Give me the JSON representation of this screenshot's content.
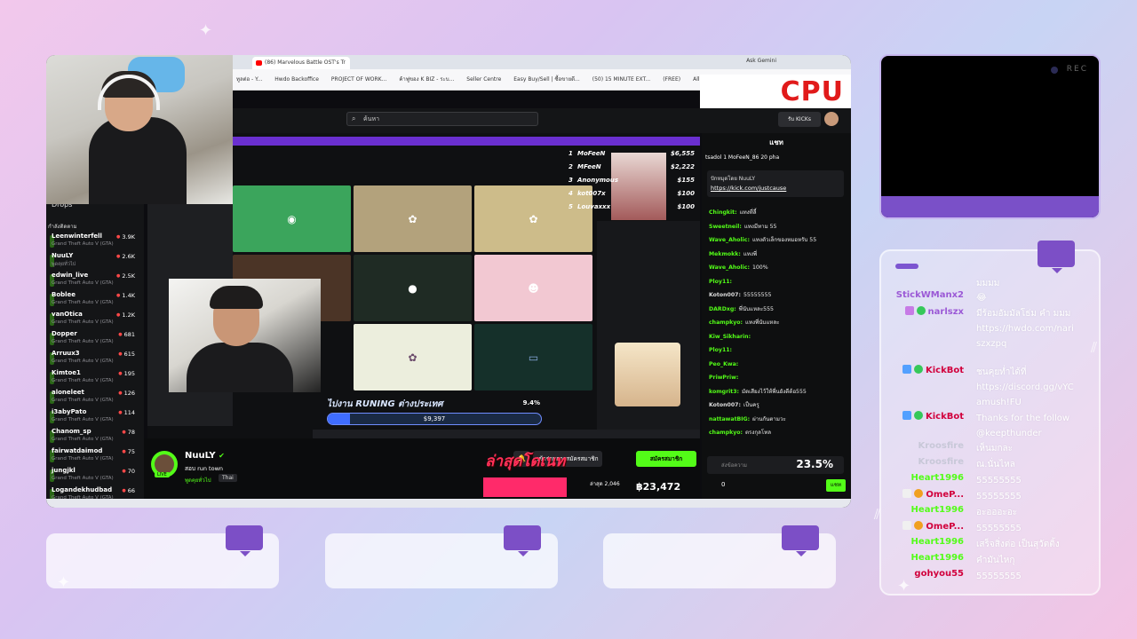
{
  "browser": {
    "tab_title": "(86) Marvelous Battle OST's Tr",
    "ask_gemini": "Ask Gemini",
    "bookmarks": [
      "ทูลต่อ - Y...",
      "Hwdo Backoffice",
      "PROJECT OF WORK...",
      "ค้าฟูของ K BIZ - ระบ...",
      "Seller Centre",
      "Easy Buy/Sell | ซื้อขายดี...",
      "(50) 15 MINUTE EXT...",
      "(FREE)",
      "All Bookmarks"
    ],
    "logo_text": "CPU"
  },
  "kick": {
    "search_placeholder": "ค้นหา",
    "kicks_button": "รับ KICKs"
  },
  "sidebar": {
    "drops_label": "Drops",
    "recommended_label": "กำลังติดตาม",
    "items": [
      {
        "name": "Leenwinterfell",
        "game": "Grand Theft Auto V (GTA)",
        "viewers": "3.9K"
      },
      {
        "name": "NuuLY",
        "game": "พูดคุยทั่วไป",
        "viewers": "2.6K"
      },
      {
        "name": "edwin_live",
        "game": "Grand Theft Auto V (GTA)",
        "viewers": "2.5K"
      },
      {
        "name": "Boblee",
        "game": "Grand Theft Auto V (GTA)",
        "viewers": "1.4K"
      },
      {
        "name": "vanOtica",
        "game": "Grand Theft Auto V (GTA)",
        "viewers": "1.2K"
      },
      {
        "name": "Dopper",
        "game": "Grand Theft Auto V (GTA)",
        "viewers": "681"
      },
      {
        "name": "Arruux3",
        "game": "Grand Theft Auto V (GTA)",
        "viewers": "615"
      },
      {
        "name": "Kimtoe1",
        "game": "Grand Theft Auto V (GTA)",
        "viewers": "195"
      },
      {
        "name": "aloneleet",
        "game": "Grand Theft Auto V (GTA)",
        "viewers": "126"
      },
      {
        "name": "i3abyPato",
        "game": "Grand Theft Auto V (GTA)",
        "viewers": "114"
      },
      {
        "name": "Chanom_sp",
        "game": "Grand Theft Auto V (GTA)",
        "viewers": "78"
      },
      {
        "name": "fairwatdaimod",
        "game": "Grand Theft Auto V (GTA)",
        "viewers": "75"
      },
      {
        "name": "jungjkl",
        "game": "Grand Theft Auto V (GTA)",
        "viewers": "70"
      },
      {
        "name": "Logandekhudbad",
        "game": "Grand Theft Auto V (GTA)",
        "viewers": "66"
      }
    ]
  },
  "leaderboard": [
    {
      "rank": "1",
      "name": "MoFeeN",
      "amount": "$6,555"
    },
    {
      "rank": "2",
      "name": "MFeeN",
      "amount": "$2,222"
    },
    {
      "rank": "3",
      "name": "Anonymous",
      "amount": "$155"
    },
    {
      "rank": "4",
      "name": "kot007x",
      "amount": "$100"
    },
    {
      "rank": "5",
      "name": "Louvaxxx",
      "amount": "$100"
    }
  ],
  "goal": {
    "title": "ไปงาน RUNING ต่างประเทศ",
    "percent_label": "9.4%",
    "progress": 0.094,
    "value": "$9,397"
  },
  "streamer": {
    "name": "NuuLY",
    "stream_title": "สอบ run town",
    "category": "พูดคุยทั่วไป",
    "language": "Thai",
    "live_label": "LIVE",
    "subscribe_label": "เข้าร่วมการสมัครสมาชิก",
    "follow_label": "สมัครสมาชิก",
    "overlay_text": "ล่าสุดโดเนท",
    "donate_label": "ล่าสุด 2,046",
    "donate_current": "฿23,472",
    "zero_count": "0"
  },
  "kick_chat": {
    "header": "แชท",
    "pin_top": "tsadol 1   MoFeeN_86 20   pha",
    "pin_by": "ปักหมุดโดย NuuLY",
    "pin_link": "https://kick.com/justcause",
    "input_placeholder": "ส่งข้อความ",
    "input_percent": "23.5%",
    "send_label": "แชท",
    "messages": [
      {
        "user": "Chingkit:",
        "text": "แทงที่ลี้",
        "color": "#53fc18"
      },
      {
        "user": "Sweetneil:",
        "text": "แทงมีทาม 55",
        "color": "#53fc18"
      },
      {
        "user": "Wave_Aholic:",
        "text": "แทงตัวเล็กของหมอหรับ 55",
        "color": "#53fc18"
      },
      {
        "user": "Mekmokk:",
        "text": "แทงพี่",
        "color": "#53fc18"
      },
      {
        "user": "Wave_Aholic:",
        "text": "100%",
        "color": "#53fc18"
      },
      {
        "user": "Ploy11:",
        "text": "",
        "color": "#53fc18"
      },
      {
        "user": "Koton007:",
        "text": "55555555",
        "color": "#dcdcdc"
      },
      {
        "user": "DARDxg:",
        "text": "พี่นับแหละ555",
        "color": "#53fc18"
      },
      {
        "user": "champkyo:",
        "text": "แทงพี่นับแหละ",
        "color": "#53fc18"
      },
      {
        "user": "Kiw_Sikharin:",
        "text": "",
        "color": "#53fc18"
      },
      {
        "user": "Ploy11:",
        "text": "",
        "color": "#53fc18"
      },
      {
        "user": "Peo_Kwa:",
        "text": "",
        "color": "#53fc18"
      },
      {
        "user": "PriwPriw:",
        "text": "",
        "color": "#53fc18"
      },
      {
        "user": "komgrit3:",
        "text": "มัดเสียงไว้ให้พี่นยังดีต้อ555",
        "color": "#53fc18"
      },
      {
        "user": "Koton007:",
        "text": "เป็นครู",
        "color": "#dcdcdc"
      },
      {
        "user": "nattawatBIG:",
        "text": "ผ่านกันตามวะ",
        "color": "#53fc18"
      },
      {
        "user": "champkyo:",
        "text": "ตรงกุลโทล",
        "color": "#53fc18"
      }
    ]
  },
  "rec_box": {
    "rec_label": "REC"
  },
  "overlay_chat": [
    {
      "user": "",
      "text": "มมมม",
      "color": "#7c55d0",
      "badge": "none"
    },
    {
      "user": "StickWManx2",
      "text": "😂",
      "color": "#9b59d6",
      "badge": "none"
    },
    {
      "user": "narlszx",
      "text": "มีร้อมอัมมัลโธ่ม คำ มมม https://hwdo.com/nari szxzpq",
      "color": "#9b59d6",
      "badge": "mic"
    },
    {
      "user": "KickBot",
      "text": "ชนคุยท่ำได้ที่ https://discord.gg/vYC amush!FU",
      "color": "#d1003c",
      "badge": "bot"
    },
    {
      "user": "KickBot",
      "text": "Thanks for the follow @keepthunder",
      "color": "#d1003c",
      "badge": "bot"
    },
    {
      "user": "Kroosfire",
      "text": "เห็นมกละ",
      "color": "#c8c8d8",
      "badge": "none"
    },
    {
      "user": "Kroosfire",
      "text": "ณ.นั่นไหล",
      "color": "#c8c8d8",
      "badge": "none"
    },
    {
      "user": "Heart1996",
      "text": "55555555",
      "color": "#53fc18",
      "badge": "none"
    },
    {
      "user": "OmeP...",
      "text": "55555555",
      "color": "#d1003c",
      "badge": "sub"
    },
    {
      "user": "Heart1996",
      "text": "อะอออะอะ",
      "color": "#53fc18",
      "badge": "none"
    },
    {
      "user": "OmeP...",
      "text": "55555555",
      "color": "#d1003c",
      "badge": "sub"
    },
    {
      "user": "Heart1996",
      "text": "เสร็จสิ่งต่อ เป็นสุวัตติ้ง",
      "color": "#53fc18",
      "badge": "none"
    },
    {
      "user": "Heart1996",
      "text": "คำมันไหกุ",
      "color": "#53fc18",
      "badge": "none"
    },
    {
      "user": "gohyou55",
      "text": "55555555",
      "color": "#d1003c",
      "badge": "none"
    }
  ],
  "colors": {
    "kick_green": "#53fc18",
    "accent_purple": "#7c4fc6",
    "live_red": "#ff2a6a"
  }
}
